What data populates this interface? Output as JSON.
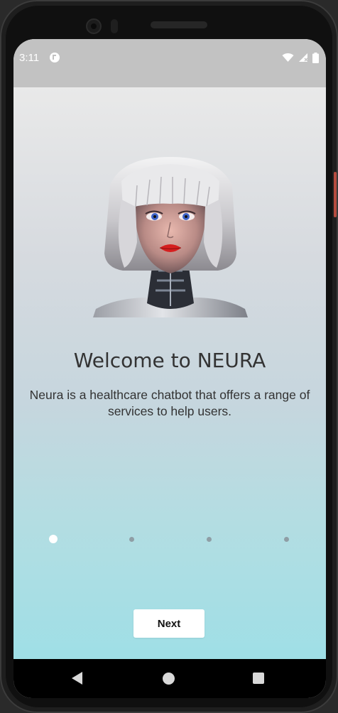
{
  "status_bar": {
    "time": "3:11",
    "app_icon": "pocket-casts-icon",
    "icons": [
      "wifi-icon",
      "signal-icon",
      "battery-icon"
    ]
  },
  "onboarding": {
    "image": "robot-woman-portrait",
    "title": "Welcome to NEURA",
    "description": "Neura is a healthcare chatbot that offers a range of services to help users.",
    "page_count": 4,
    "active_page": 1,
    "next_label": "Next"
  },
  "nav_bar": {
    "buttons": [
      "back-icon",
      "home-icon",
      "recents-icon"
    ]
  },
  "colors": {
    "status_bar_bg": "#c2c2c2",
    "gradient_top": "#e9e9e9",
    "gradient_bottom": "#9fdfe6",
    "text": "#333333",
    "dot_active": "#ffffff",
    "dot_inactive": "#8f9ea5"
  }
}
